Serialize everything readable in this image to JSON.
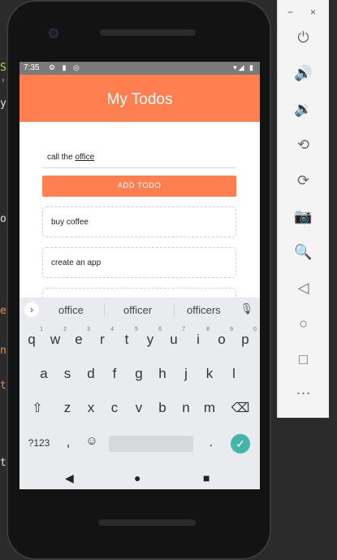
{
  "bg_code": {
    "lines": [
      {
        "text": "S",
        "color": "#a6e22e"
      },
      {
        "text": "'",
        "color": "#f08d49"
      },
      {
        "text": "y",
        "color": "#e0e0e0"
      },
      {
        "text": "",
        "color": "#e0e0e0"
      },
      {
        "text": "o",
        "color": "#e0e0e0"
      },
      {
        "text": "e",
        "color": "#f08d49"
      },
      {
        "text": "n",
        "color": "#f08d49"
      },
      {
        "text": "t",
        "color": "#f08d49"
      },
      {
        "text": "t",
        "color": "#e0e0e0"
      }
    ]
  },
  "status_bar": {
    "time": "7:35",
    "left_icons": "⚙ ▮ ◎",
    "right_icons": "▾◢ ▮"
  },
  "app_bar": {
    "title": "My Todos"
  },
  "todo_input": {
    "value_prefix": "call the ",
    "value_composing": "office"
  },
  "add_button": {
    "label": "ADD TODO"
  },
  "todos": [
    {
      "text": "buy coffee"
    },
    {
      "text": "create an app"
    },
    {
      "text": ""
    }
  ],
  "keyboard": {
    "suggestions": [
      "office",
      "officer",
      "officers"
    ],
    "row1": [
      {
        "k": "q",
        "n": "1"
      },
      {
        "k": "w",
        "n": "2"
      },
      {
        "k": "e",
        "n": "3"
      },
      {
        "k": "r",
        "n": "4"
      },
      {
        "k": "t",
        "n": "5"
      },
      {
        "k": "y",
        "n": "6"
      },
      {
        "k": "u",
        "n": "7"
      },
      {
        "k": "i",
        "n": "8"
      },
      {
        "k": "o",
        "n": "9"
      },
      {
        "k": "p",
        "n": "0"
      }
    ],
    "row2": [
      "a",
      "s",
      "d",
      "f",
      "g",
      "h",
      "j",
      "k",
      "l"
    ],
    "row3": [
      "z",
      "x",
      "c",
      "v",
      "b",
      "n",
      "m"
    ],
    "symbols_key": "?123",
    "comma_key": ",",
    "period_key": "."
  },
  "toolbar": {
    "minimize": "−",
    "close": "×"
  }
}
